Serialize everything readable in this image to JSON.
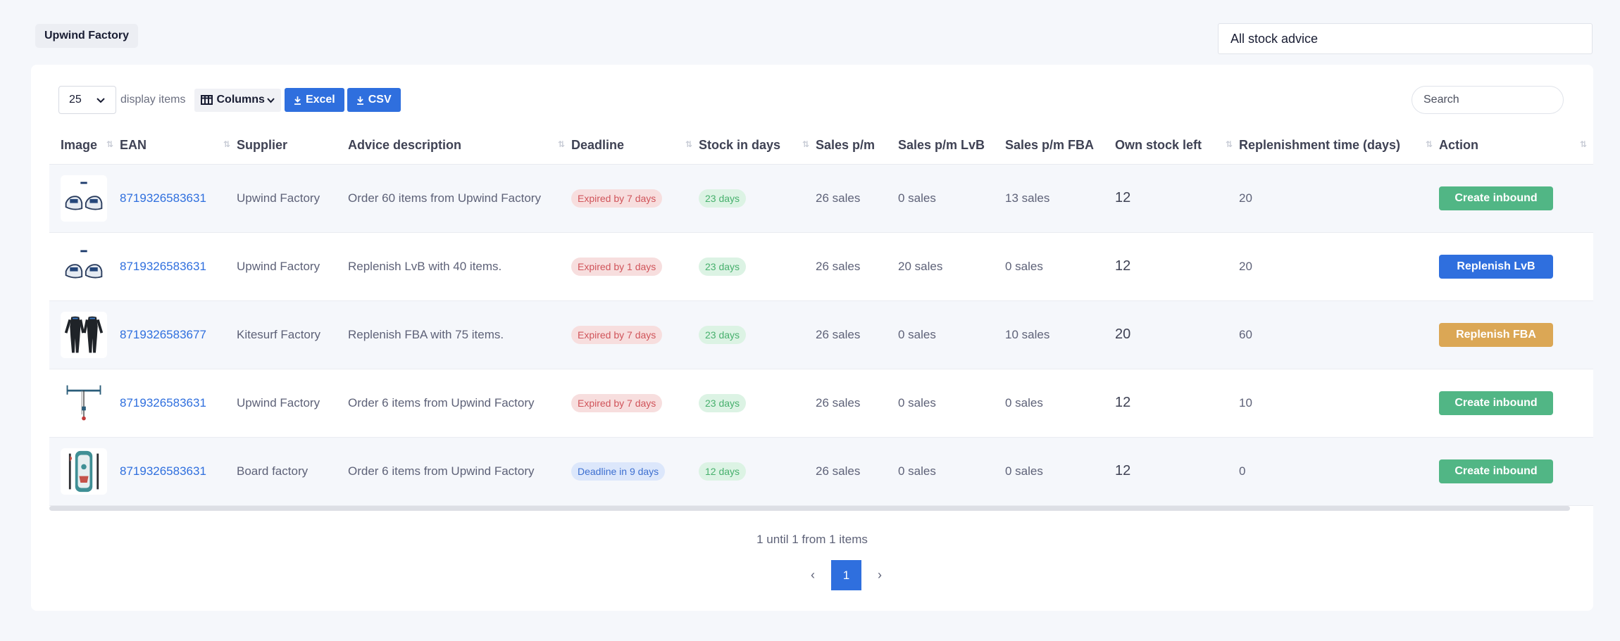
{
  "header": {
    "tag": "Upwind Factory",
    "filter": "All stock advice"
  },
  "toolbar": {
    "page_length": "25",
    "page_length_label": "display items",
    "columns_label": "Columns",
    "excel_label": "Excel",
    "csv_label": "CSV",
    "search_placeholder": "Search"
  },
  "columns": [
    "Image",
    "EAN",
    "Supplier",
    "Advice description",
    "Deadline",
    "Stock in days",
    "Sales p/m",
    "Sales p/m LvB",
    "Sales p/m FBA",
    "Own stock left",
    "Replenishment time (days)",
    "Action"
  ],
  "rows": [
    {
      "image": "shoe-icon",
      "ean": "8719326583631",
      "supplier": "Upwind Factory",
      "description": "Order 60 items from Upwind Factory",
      "deadline": "Expired by 7 days",
      "deadline_status": "expired",
      "stock_days": "23 days",
      "sales_pm": "26 sales",
      "sales_lvb": "0 sales",
      "sales_fba": "13 sales",
      "own_stock": "12",
      "replenishment": "20",
      "action": "Create inbound",
      "action_color": "#51b685"
    },
    {
      "image": "shoe-icon",
      "ean": "8719326583631",
      "supplier": "Upwind Factory",
      "description": "Replenish LvB with 40 items.",
      "deadline": "Expired by 1 days",
      "deadline_status": "expired",
      "stock_days": "23 days",
      "sales_pm": "26 sales",
      "sales_lvb": "20 sales",
      "sales_fba": "0 sales",
      "own_stock": "12",
      "replenishment": "20",
      "action": "Replenish LvB",
      "action_color": "#2f6fde"
    },
    {
      "image": "wetsuit-icon",
      "ean": "8719326583677",
      "supplier": "Kitesurf Factory",
      "description": "Replenish FBA with 75 items.",
      "deadline": "Expired by 7 days",
      "deadline_status": "expired",
      "stock_days": "23 days",
      "sales_pm": "26 sales",
      "sales_lvb": "0 sales",
      "sales_fba": "10 sales",
      "own_stock": "20",
      "replenishment": "60",
      "action": "Replenish FBA",
      "action_color": "#dba755"
    },
    {
      "image": "kite-bar-icon",
      "ean": "8719326583631",
      "supplier": "Upwind Factory",
      "description": "Order 6 items from Upwind Factory",
      "deadline": "Expired by 7 days",
      "deadline_status": "expired",
      "stock_days": "23 days",
      "sales_pm": "26 sales",
      "sales_lvb": "0 sales",
      "sales_fba": "0 sales",
      "own_stock": "12",
      "replenishment": "10",
      "action": "Create inbound",
      "action_color": "#51b685"
    },
    {
      "image": "surfboard-icon",
      "ean": "8719326583631",
      "supplier": "Board factory",
      "description": "Order 6 items from Upwind Factory",
      "deadline": "Deadline in 9 days",
      "deadline_status": "upcoming",
      "stock_days": "12 days",
      "sales_pm": "26 sales",
      "sales_lvb": "0 sales",
      "sales_fba": "0 sales",
      "own_stock": "12",
      "replenishment": "0",
      "action": "Create inbound",
      "action_color": "#51b685"
    }
  ],
  "footer": {
    "info": "1 until 1 from 1 items",
    "current_page": "1",
    "prev": "‹",
    "next": "›"
  }
}
